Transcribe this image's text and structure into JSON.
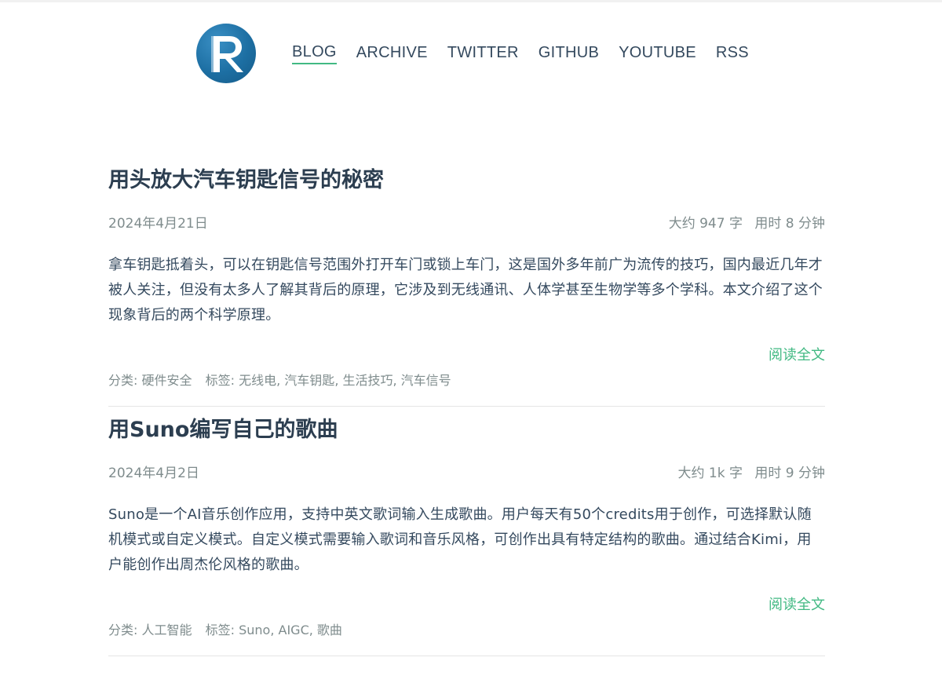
{
  "brand": {
    "logo_letter": "R",
    "logo_color": "#1d6fa3"
  },
  "nav": {
    "items": [
      {
        "label": "BLOG",
        "active": true
      },
      {
        "label": "ARCHIVE"
      },
      {
        "label": "TWITTER"
      },
      {
        "label": "GITHUB"
      },
      {
        "label": "YOUTUBE"
      },
      {
        "label": "RSS"
      }
    ]
  },
  "colors": {
    "accent": "#42b983",
    "text": "#34495e",
    "meta": "#7f8c8d"
  },
  "posts": [
    {
      "title": "用头放大汽车钥匙信号的秘密",
      "date": "2024年4月21日",
      "words": "大约 947 字",
      "time": "用时 8 分钟",
      "excerpt": "拿车钥匙抵着头，可以在钥匙信号范围外打开车门或锁上车门，这是国外多年前广为流传的技巧，国内最近几年才被人关注，但没有太多人了解其背后的原理，它涉及到无线通讯、人体学甚至生物学等多个学科。本文介绍了这个现象背后的两个科学原理。",
      "read_more": "阅读全文",
      "category_label": "分类:",
      "category": "硬件安全",
      "tags_label": "标签:",
      "tags": [
        "无线电",
        "汽车钥匙",
        "生活技巧",
        "汽车信号"
      ]
    },
    {
      "title": "用Suno编写自己的歌曲",
      "date": "2024年4月2日",
      "words": "大约 1k 字",
      "time": "用时 9 分钟",
      "excerpt": "Suno是一个AI音乐创作应用，支持中英文歌词输入生成歌曲。用户每天有50个credits用于创作，可选择默认随机模式或自定义模式。自定义模式需要输入歌词和音乐风格，可创作出具有特定结构的歌曲。通过结合Kimi，用户能创作出周杰伦风格的歌曲。",
      "read_more": "阅读全文",
      "category_label": "分类:",
      "category": "人工智能",
      "tags_label": "标签:",
      "tags": [
        "Suno",
        "AIGC",
        "歌曲"
      ]
    }
  ]
}
